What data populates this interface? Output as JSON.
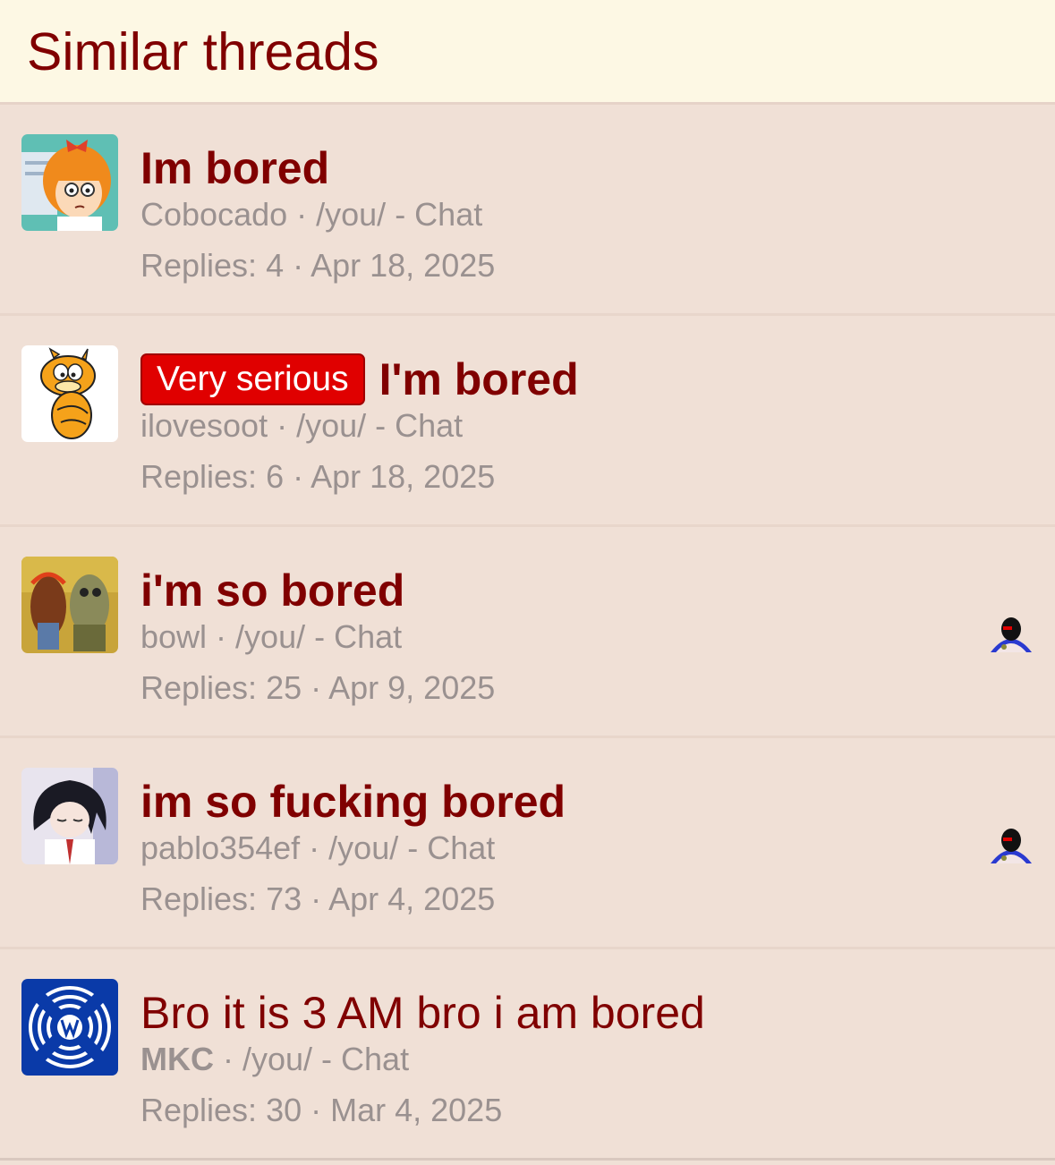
{
  "section": {
    "title": "Similar threads"
  },
  "meta_separator": " · ",
  "threads": [
    {
      "title": "Im bored",
      "prefix": "",
      "author": "Cobocado",
      "forum": "/you/ - Chat",
      "replies": "Replies: 4",
      "date": "Apr 18, 2025",
      "avatar_icon": "cartoon-girl-avatar-icon"
    },
    {
      "title": "I'm bored",
      "prefix": "Very serious",
      "author": "ilovesoot",
      "forum": "/you/ - Chat",
      "replies": "Replies: 6",
      "date": "Apr 18, 2025",
      "avatar_icon": "garfield-avatar-icon"
    },
    {
      "title": "i'm so bored",
      "prefix": "",
      "author": "bowl",
      "forum": "/you/ - Chat",
      "replies": "Replies: 25",
      "date": "Apr 9, 2025",
      "avatar_icon": "painting-avatar-icon",
      "last_poster_icon": "black-bird-avatar-icon"
    },
    {
      "title": "im so fucking bored",
      "prefix": "",
      "author": "pablo354ef",
      "forum": "/you/ - Chat",
      "replies": "Replies: 73",
      "date": "Apr 4, 2025",
      "avatar_icon": "anime-girl-avatar-icon",
      "last_poster_icon": "black-bird-avatar-icon"
    },
    {
      "title": "Bro it is 3 AM bro i am bored",
      "prefix": "",
      "author": "MKC",
      "forum": "/you/ - Chat",
      "replies": "Replies: 30",
      "date": "Mar 4, 2025",
      "avatar_icon": "blue-logo-avatar-icon"
    }
  ],
  "colors": {
    "background": "#f0e0d6",
    "header_background": "#fdf8e4",
    "title": "#800000",
    "meta": "#9a9190",
    "prefix_badge": "#e00000",
    "logo_blue": "#0a3aa8"
  }
}
